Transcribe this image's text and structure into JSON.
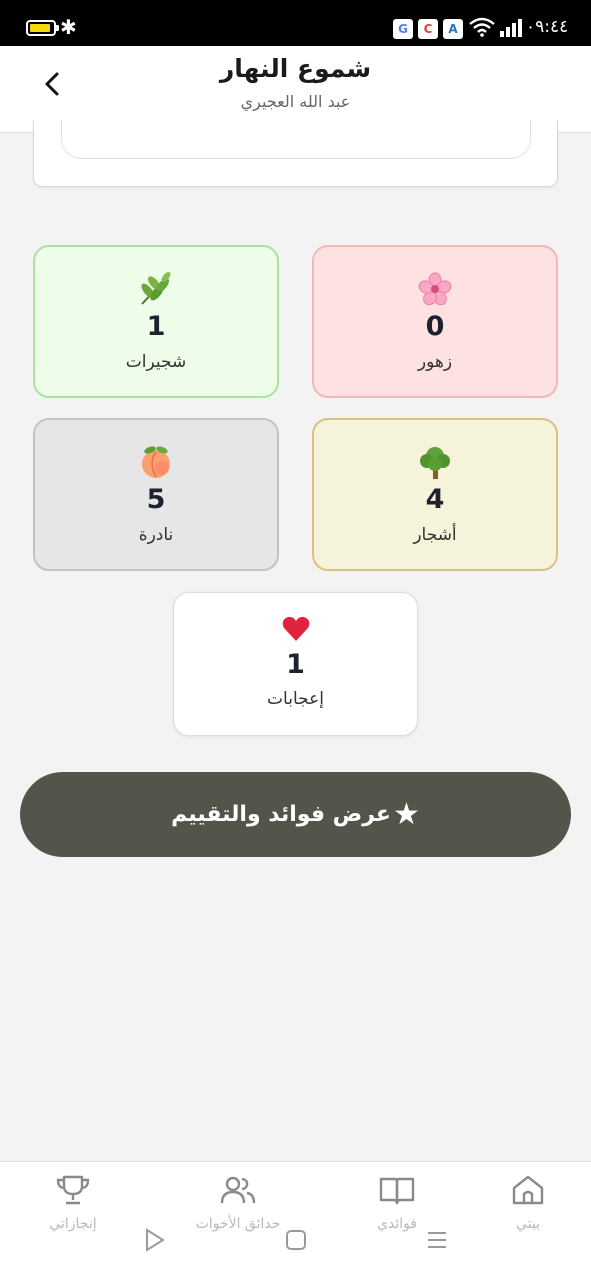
{
  "status_bar": {
    "time": "٠٩:٤٤",
    "notifications": [
      "G",
      "C",
      "A"
    ]
  },
  "header": {
    "title": "شموع النهار",
    "subtitle": "عبد الله العجيري",
    "back_icon": "chevron-left-icon"
  },
  "stats": {
    "flowers": {
      "emoji": "🌸",
      "icon": "cherry-blossom-icon",
      "count": "0",
      "label": "زهور",
      "color": "#fde2e1"
    },
    "shrubs": {
      "emoji": "🌿",
      "icon": "herb-icon",
      "count": "1",
      "label": "شجيرات",
      "color": "#eefcea"
    },
    "trees": {
      "emoji": "🌳",
      "icon": "tree-icon",
      "count": "4",
      "label": "أشجار",
      "color": "#f5f4da"
    },
    "rare": {
      "emoji": "🍑",
      "icon": "peach-icon",
      "count": "5",
      "label": "نادرة",
      "color": "#e6e6e6"
    },
    "likes": {
      "emoji": "♥",
      "icon": "heart-icon",
      "count": "1",
      "label": "إعجابات",
      "color": "#ffffff"
    }
  },
  "benefits_button": {
    "star": "★",
    "label": "عرض فوائد والتقييم",
    "color": "#55544b"
  },
  "bottom_nav": {
    "home": "بيتي",
    "benefits": "فوائدي",
    "sisters": "حدائق الأخوات",
    "achievements": "إنجازاتي"
  }
}
